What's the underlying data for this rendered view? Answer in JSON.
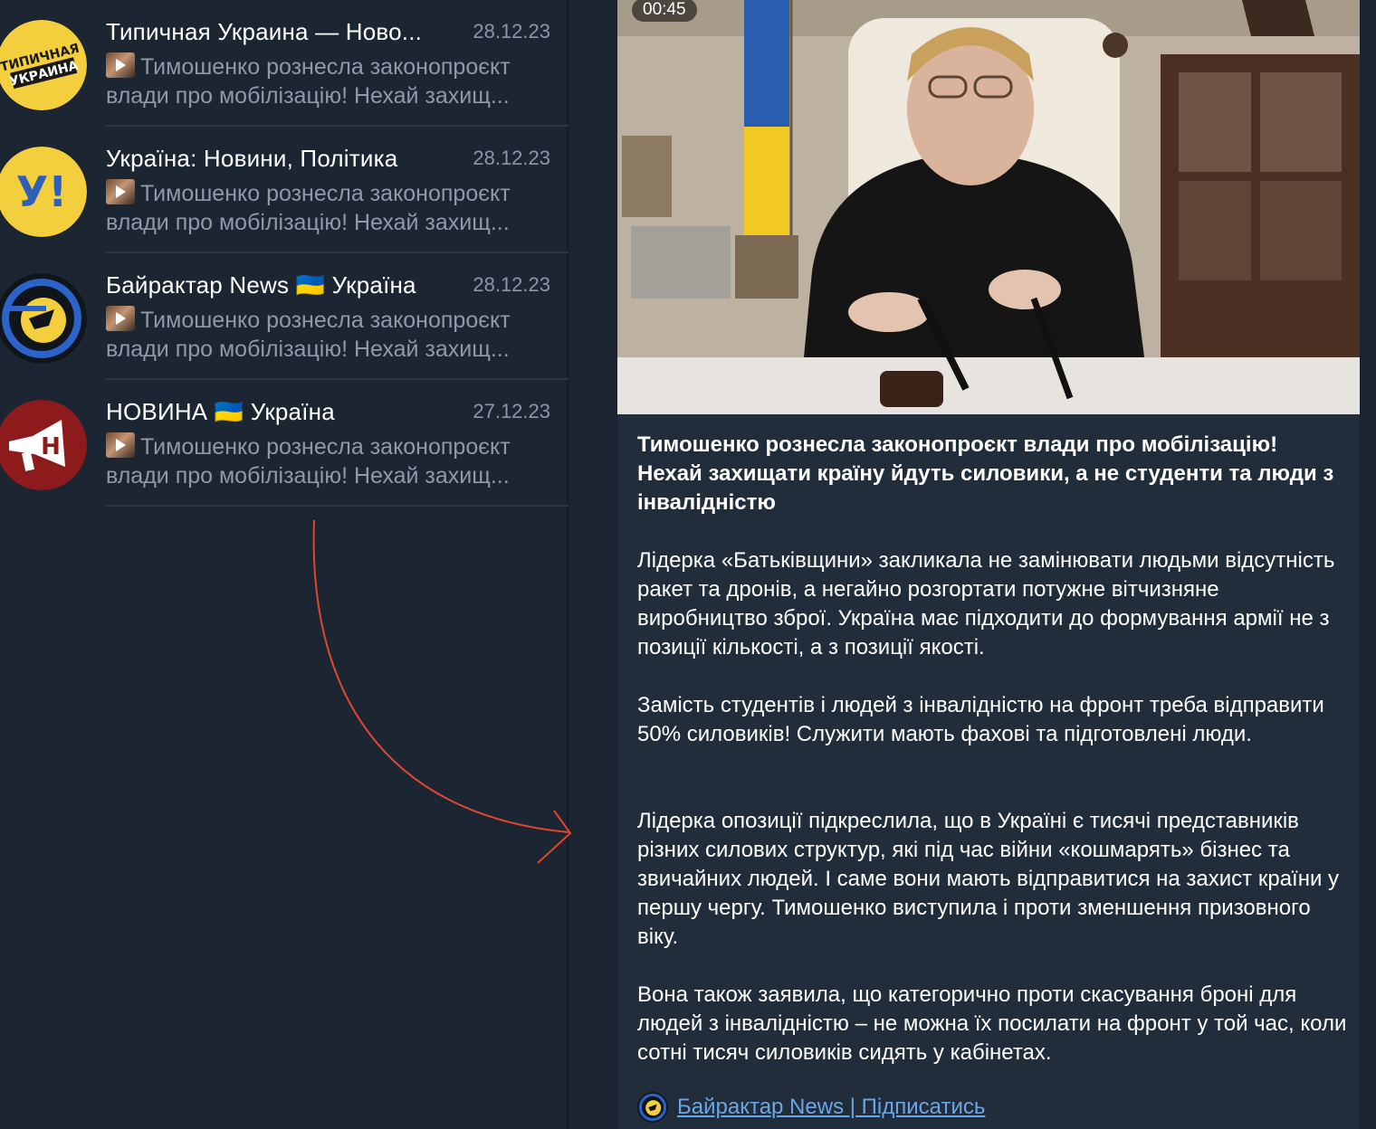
{
  "chats": [
    {
      "name": "Типичная Украина — Ново...",
      "date": "28.12.23",
      "preview_line1": "Тимошенко рознесла законопроєкт",
      "preview_line2": "влади про мобілізацію! Нехай захищ...",
      "avatar_text_1": "ТИПИЧНАЯ",
      "avatar_text_2": "УКРАИНА"
    },
    {
      "name": "Україна: Новини, Політика",
      "date": "28.12.23",
      "preview_line1": "Тимошенко рознесла законопроєкт",
      "preview_line2": "влади про мобілізацію! Нехай захищ...",
      "avatar_text_1": "У!"
    },
    {
      "name": "Байрактар News 🇺🇦 Україна",
      "date": "28.12.23",
      "preview_line1": "Тимошенко рознесла законопроєкт",
      "preview_line2": "влади про мобілізацію! Нехай захищ..."
    },
    {
      "name": "НОВИНА 🇺🇦 Україна",
      "date": "27.12.23",
      "preview_line1": "Тимошенко рознесла законопроєкт",
      "preview_line2": "влади про мобілізацію! Нехай захищ...",
      "avatar_text_1": "Н"
    }
  ],
  "post": {
    "video_duration": "00:45",
    "title": "Тимошенко рознесла законопроєкт влади про мобілізацію! Нехай захищати країну йдуть силовики, а не студенти та люди з інвалідністю",
    "paragraphs": [
      "Лідерка «Батьківщини» закликала не замінювати людьми відсутність ракет та дронів, а негайно розгортати потужне вітчизняне виробництво зброї. Україна має підходити до формування армії не з позиції кількості, а з позиції якості.",
      "Замість студентів і людей з інвалідністю на фронт треба відправити 50% силовиків! Служити мають фахові та підготовлені люди.",
      "Лідерка опозиції підкреслила, що в Україні є тисячі представників різних силових структур, які під час війни «кошмарять» бізнес та звичайних людей. І саме вони мають відправитися на захист країни у першу чергу. Тимошенко виступила і проти зменшення призовного віку.",
      "Вона також заявила, що категорично проти скасування броні для людей з інвалідністю – не можна їх посилати на фронт у той час, коли сотні тисяч силовиків сидять у кабінетах."
    ],
    "footer_link": "Байрактар News | Підписатись"
  },
  "colors": {
    "background": "#1b2430",
    "post_background": "#222d3b",
    "link": "#6aa6e6",
    "annotation_arrow": "#e0472f"
  }
}
